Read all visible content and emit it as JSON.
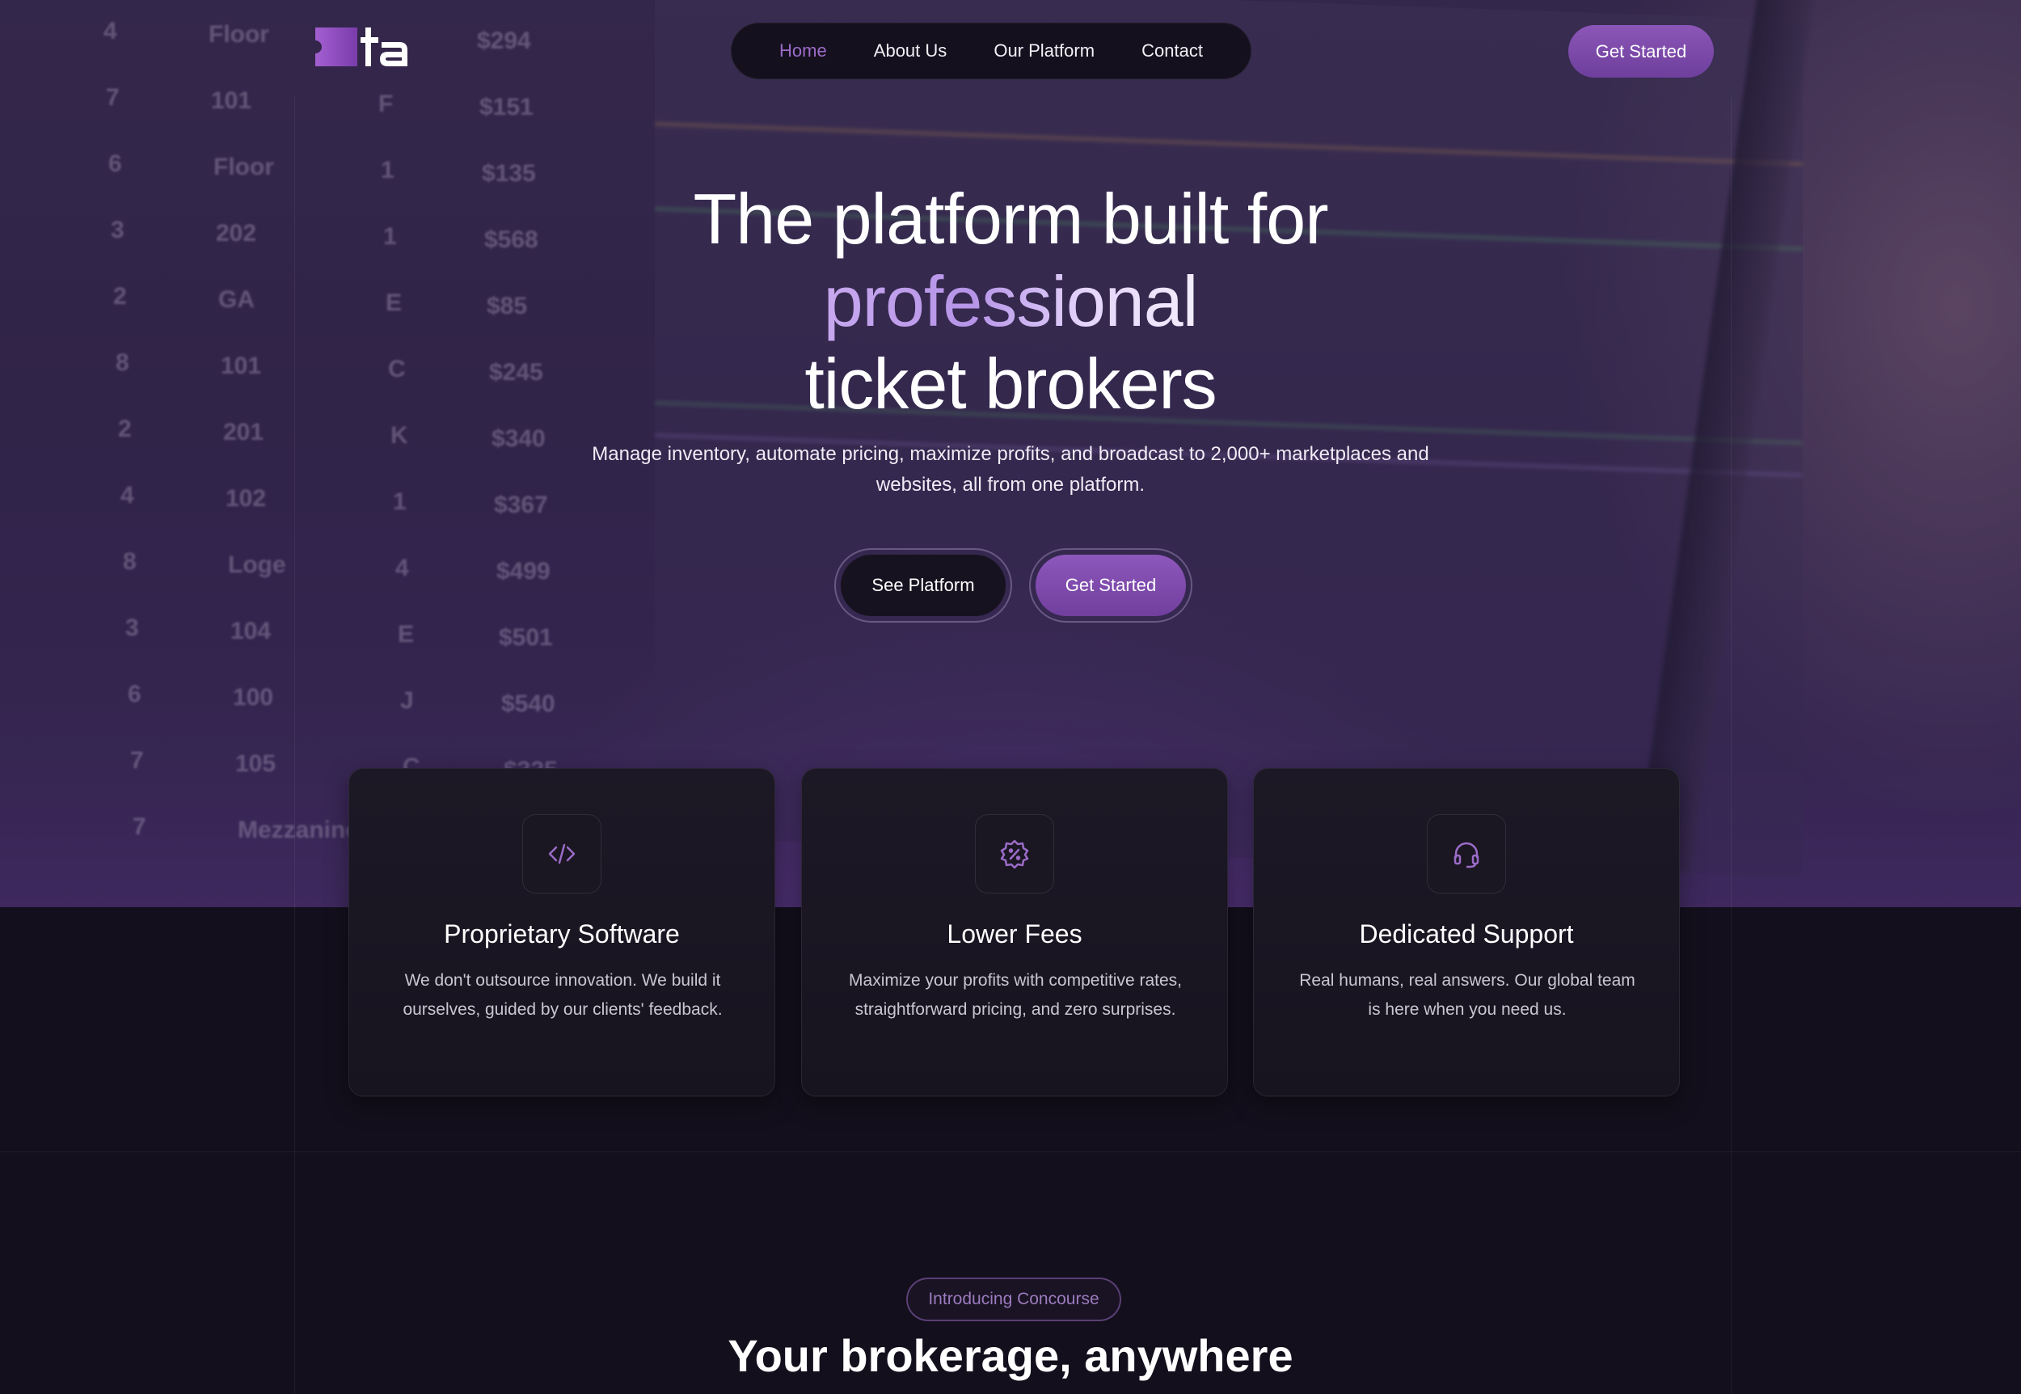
{
  "header": {
    "logo_text": "ta",
    "nav": [
      {
        "label": "Home",
        "active": true
      },
      {
        "label": "About Us",
        "active": false
      },
      {
        "label": "Our Platform",
        "active": false
      },
      {
        "label": "Contact",
        "active": false
      }
    ],
    "cta_label": "Get Started"
  },
  "hero": {
    "title_line1": "The platform built for",
    "title_accent": "professional",
    "title_line3": "ticket brokers",
    "subtitle_line1": "Manage inventory, automate pricing, maximize profits, and broadcast to 2,000+ marketplaces and",
    "subtitle_line2": "websites, all from one platform.",
    "btn_see_platform": "See Platform",
    "btn_get_started": "Get Started"
  },
  "features": [
    {
      "icon": "code-icon",
      "title": "Proprietary Software",
      "text": "We don't outsource innovation. We build it ourselves, guided by our clients' feedback."
    },
    {
      "icon": "discount-badge-icon",
      "title": "Lower Fees",
      "text": "Maximize your profits with competitive rates, straightforward pricing, and zero surprises."
    },
    {
      "icon": "headset-icon",
      "title": "Dedicated Support",
      "text": "Real humans, real answers. Our global team is here when you need us."
    }
  ],
  "concourse": {
    "badge": "Introducing Concourse",
    "title": "Your brokerage, anywhere"
  },
  "background_ticket_table": {
    "col1": [
      "4",
      "7",
      "6",
      "3",
      "2",
      "8",
      "2",
      "4",
      "8",
      "3",
      "6",
      "7",
      "7"
    ],
    "col2": [
      "Floor",
      "101",
      "Floor",
      "202",
      "GA",
      "101",
      "201",
      "102",
      "Loge",
      "104",
      "100",
      "105",
      "Mezzanine"
    ],
    "col3": [
      "",
      "F",
      "1",
      "1",
      "E",
      "C",
      "K",
      "1",
      "4",
      "E",
      "J",
      "C",
      ""
    ],
    "col4": [
      "$294",
      "$151",
      "$135",
      "$568",
      "$85",
      "$245",
      "$340",
      "$367",
      "$499",
      "$501",
      "$540",
      "$325",
      ""
    ]
  },
  "colors": {
    "accent": "#8b56b8",
    "nav_active": "#9b6cc7",
    "page_bg": "#130f1c",
    "card_bg": "#1c1825"
  }
}
